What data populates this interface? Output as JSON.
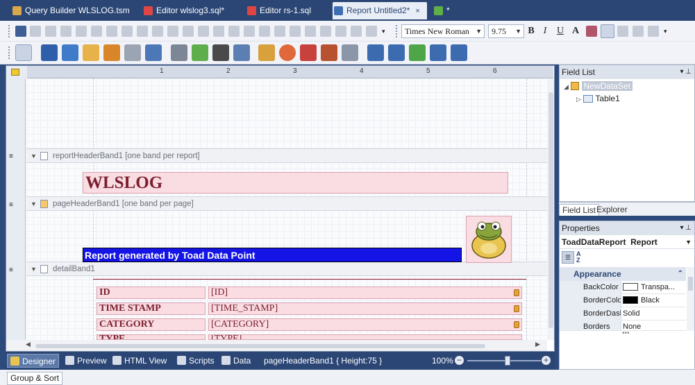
{
  "tabs": [
    {
      "label": "Query Builder WLSLOG.tsm",
      "icon": "query-builder-icon",
      "active": false,
      "close": ""
    },
    {
      "label": "Editor wlslog3.sql*",
      "icon": "sql-editor-icon",
      "active": false,
      "close": ""
    },
    {
      "label": "Editor rs-1.sql",
      "icon": "sql-editor-icon",
      "active": false,
      "close": ""
    },
    {
      "label": "Report Untitled2*",
      "icon": "report-icon",
      "active": true,
      "close": "×"
    },
    {
      "label": "*",
      "icon": "automation-icon",
      "active": false,
      "close": ""
    }
  ],
  "toolbar": {
    "font_name": "Times New Roman",
    "font_size": "9.75",
    "bold": "B",
    "italic": "I",
    "underline": "U",
    "fore_color": "A"
  },
  "ruler": {
    "marks": [
      "1",
      "2",
      "3",
      "4",
      "5",
      "6"
    ]
  },
  "bands": {
    "report_header": "reportHeaderBand1 [one band per report]",
    "page_header": "pageHeaderBand1 [one band per page]",
    "detail": "detailBand1"
  },
  "report": {
    "title": "WLSLOG",
    "subtitle": "Report generated by Toad Data Point",
    "rows": [
      {
        "label": "ID",
        "field": "[ID]"
      },
      {
        "label": "TIME STAMP",
        "field": "[TIME_STAMP]"
      },
      {
        "label": "CATEGORY",
        "field": "[CATEGORY]"
      },
      {
        "label": "TYPE",
        "field": "[TYPE]"
      }
    ]
  },
  "status": {
    "designer": "Designer",
    "preview": "Preview",
    "html_view": "HTML View",
    "scripts": "Scripts",
    "data": "Data",
    "selection": "pageHeaderBand1 { Height:75 }",
    "zoom": "100%",
    "zoom_level": 0.55
  },
  "bottom": {
    "group_sort": "Group & Sort"
  },
  "field_list": {
    "title": "Field List",
    "dataset": "NewDataSet",
    "table": "Table1",
    "tab_field_list": "Field List",
    "tab_explorer": "Explorer"
  },
  "properties": {
    "title": "Properties",
    "object": "ToadDataReport",
    "object_type": "Report",
    "category": "Appearance",
    "rows": [
      {
        "name": "BackColor",
        "value": "Transpa...",
        "swatch": "#ffffff"
      },
      {
        "name": "BorderColo",
        "value": "Black",
        "swatch": "#000000"
      },
      {
        "name": "BorderDash",
        "value": "Solid",
        "swatch": ""
      },
      {
        "name": "Borders",
        "value": "None",
        "swatch": ""
      }
    ]
  }
}
